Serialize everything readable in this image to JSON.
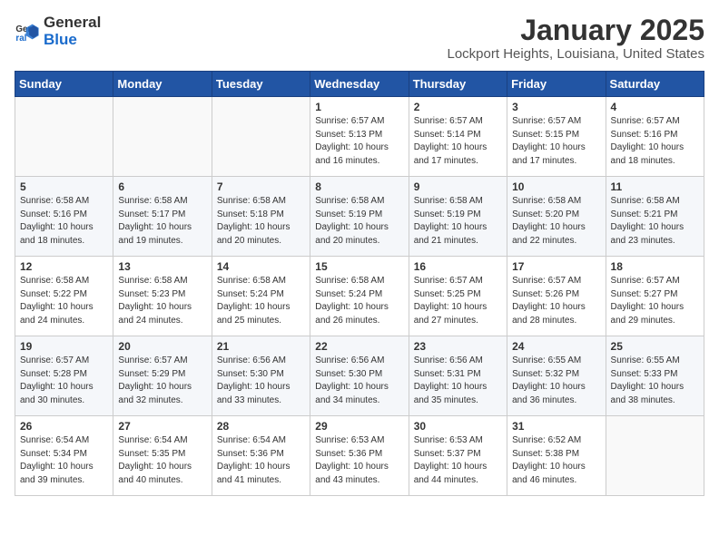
{
  "header": {
    "logo_general": "General",
    "logo_blue": "Blue",
    "month": "January 2025",
    "location": "Lockport Heights, Louisiana, United States"
  },
  "weekdays": [
    "Sunday",
    "Monday",
    "Tuesday",
    "Wednesday",
    "Thursday",
    "Friday",
    "Saturday"
  ],
  "weeks": [
    [
      {
        "day": "",
        "sunrise": "",
        "sunset": "",
        "daylight": ""
      },
      {
        "day": "",
        "sunrise": "",
        "sunset": "",
        "daylight": ""
      },
      {
        "day": "",
        "sunrise": "",
        "sunset": "",
        "daylight": ""
      },
      {
        "day": "1",
        "sunrise": "Sunrise: 6:57 AM",
        "sunset": "Sunset: 5:13 PM",
        "daylight": "Daylight: 10 hours and 16 minutes."
      },
      {
        "day": "2",
        "sunrise": "Sunrise: 6:57 AM",
        "sunset": "Sunset: 5:14 PM",
        "daylight": "Daylight: 10 hours and 17 minutes."
      },
      {
        "day": "3",
        "sunrise": "Sunrise: 6:57 AM",
        "sunset": "Sunset: 5:15 PM",
        "daylight": "Daylight: 10 hours and 17 minutes."
      },
      {
        "day": "4",
        "sunrise": "Sunrise: 6:57 AM",
        "sunset": "Sunset: 5:16 PM",
        "daylight": "Daylight: 10 hours and 18 minutes."
      }
    ],
    [
      {
        "day": "5",
        "sunrise": "Sunrise: 6:58 AM",
        "sunset": "Sunset: 5:16 PM",
        "daylight": "Daylight: 10 hours and 18 minutes."
      },
      {
        "day": "6",
        "sunrise": "Sunrise: 6:58 AM",
        "sunset": "Sunset: 5:17 PM",
        "daylight": "Daylight: 10 hours and 19 minutes."
      },
      {
        "day": "7",
        "sunrise": "Sunrise: 6:58 AM",
        "sunset": "Sunset: 5:18 PM",
        "daylight": "Daylight: 10 hours and 20 minutes."
      },
      {
        "day": "8",
        "sunrise": "Sunrise: 6:58 AM",
        "sunset": "Sunset: 5:19 PM",
        "daylight": "Daylight: 10 hours and 20 minutes."
      },
      {
        "day": "9",
        "sunrise": "Sunrise: 6:58 AM",
        "sunset": "Sunset: 5:19 PM",
        "daylight": "Daylight: 10 hours and 21 minutes."
      },
      {
        "day": "10",
        "sunrise": "Sunrise: 6:58 AM",
        "sunset": "Sunset: 5:20 PM",
        "daylight": "Daylight: 10 hours and 22 minutes."
      },
      {
        "day": "11",
        "sunrise": "Sunrise: 6:58 AM",
        "sunset": "Sunset: 5:21 PM",
        "daylight": "Daylight: 10 hours and 23 minutes."
      }
    ],
    [
      {
        "day": "12",
        "sunrise": "Sunrise: 6:58 AM",
        "sunset": "Sunset: 5:22 PM",
        "daylight": "Daylight: 10 hours and 24 minutes."
      },
      {
        "day": "13",
        "sunrise": "Sunrise: 6:58 AM",
        "sunset": "Sunset: 5:23 PM",
        "daylight": "Daylight: 10 hours and 24 minutes."
      },
      {
        "day": "14",
        "sunrise": "Sunrise: 6:58 AM",
        "sunset": "Sunset: 5:24 PM",
        "daylight": "Daylight: 10 hours and 25 minutes."
      },
      {
        "day": "15",
        "sunrise": "Sunrise: 6:58 AM",
        "sunset": "Sunset: 5:24 PM",
        "daylight": "Daylight: 10 hours and 26 minutes."
      },
      {
        "day": "16",
        "sunrise": "Sunrise: 6:57 AM",
        "sunset": "Sunset: 5:25 PM",
        "daylight": "Daylight: 10 hours and 27 minutes."
      },
      {
        "day": "17",
        "sunrise": "Sunrise: 6:57 AM",
        "sunset": "Sunset: 5:26 PM",
        "daylight": "Daylight: 10 hours and 28 minutes."
      },
      {
        "day": "18",
        "sunrise": "Sunrise: 6:57 AM",
        "sunset": "Sunset: 5:27 PM",
        "daylight": "Daylight: 10 hours and 29 minutes."
      }
    ],
    [
      {
        "day": "19",
        "sunrise": "Sunrise: 6:57 AM",
        "sunset": "Sunset: 5:28 PM",
        "daylight": "Daylight: 10 hours and 30 minutes."
      },
      {
        "day": "20",
        "sunrise": "Sunrise: 6:57 AM",
        "sunset": "Sunset: 5:29 PM",
        "daylight": "Daylight: 10 hours and 32 minutes."
      },
      {
        "day": "21",
        "sunrise": "Sunrise: 6:56 AM",
        "sunset": "Sunset: 5:30 PM",
        "daylight": "Daylight: 10 hours and 33 minutes."
      },
      {
        "day": "22",
        "sunrise": "Sunrise: 6:56 AM",
        "sunset": "Sunset: 5:30 PM",
        "daylight": "Daylight: 10 hours and 34 minutes."
      },
      {
        "day": "23",
        "sunrise": "Sunrise: 6:56 AM",
        "sunset": "Sunset: 5:31 PM",
        "daylight": "Daylight: 10 hours and 35 minutes."
      },
      {
        "day": "24",
        "sunrise": "Sunrise: 6:55 AM",
        "sunset": "Sunset: 5:32 PM",
        "daylight": "Daylight: 10 hours and 36 minutes."
      },
      {
        "day": "25",
        "sunrise": "Sunrise: 6:55 AM",
        "sunset": "Sunset: 5:33 PM",
        "daylight": "Daylight: 10 hours and 38 minutes."
      }
    ],
    [
      {
        "day": "26",
        "sunrise": "Sunrise: 6:54 AM",
        "sunset": "Sunset: 5:34 PM",
        "daylight": "Daylight: 10 hours and 39 minutes."
      },
      {
        "day": "27",
        "sunrise": "Sunrise: 6:54 AM",
        "sunset": "Sunset: 5:35 PM",
        "daylight": "Daylight: 10 hours and 40 minutes."
      },
      {
        "day": "28",
        "sunrise": "Sunrise: 6:54 AM",
        "sunset": "Sunset: 5:36 PM",
        "daylight": "Daylight: 10 hours and 41 minutes."
      },
      {
        "day": "29",
        "sunrise": "Sunrise: 6:53 AM",
        "sunset": "Sunset: 5:36 PM",
        "daylight": "Daylight: 10 hours and 43 minutes."
      },
      {
        "day": "30",
        "sunrise": "Sunrise: 6:53 AM",
        "sunset": "Sunset: 5:37 PM",
        "daylight": "Daylight: 10 hours and 44 minutes."
      },
      {
        "day": "31",
        "sunrise": "Sunrise: 6:52 AM",
        "sunset": "Sunset: 5:38 PM",
        "daylight": "Daylight: 10 hours and 46 minutes."
      },
      {
        "day": "",
        "sunrise": "",
        "sunset": "",
        "daylight": ""
      }
    ]
  ]
}
